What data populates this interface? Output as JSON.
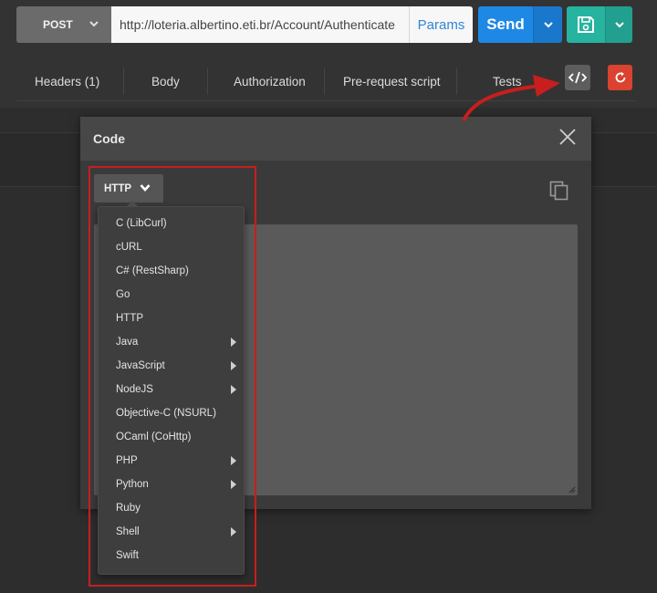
{
  "request": {
    "method": "POST",
    "url": "http://loteria.albertino.eti.br/Account/Authenticate",
    "params_label": "Params",
    "send_label": "Send"
  },
  "tabs": [
    {
      "label": "Headers (1)"
    },
    {
      "label": "Body"
    },
    {
      "label": "Authorization"
    },
    {
      "label": "Pre-request script"
    },
    {
      "label": "Tests"
    }
  ],
  "modal": {
    "title": "Code",
    "selected_language": "HTTP",
    "languages": [
      {
        "label": "C (LibCurl)",
        "submenu": false
      },
      {
        "label": "cURL",
        "submenu": false
      },
      {
        "label": "C# (RestSharp)",
        "submenu": false
      },
      {
        "label": "Go",
        "submenu": false
      },
      {
        "label": "HTTP",
        "submenu": false
      },
      {
        "label": "Java",
        "submenu": true
      },
      {
        "label": "JavaScript",
        "submenu": true
      },
      {
        "label": "NodeJS",
        "submenu": true
      },
      {
        "label": "Objective-C (NSURL)",
        "submenu": false
      },
      {
        "label": "OCaml (CoHttp)",
        "submenu": false
      },
      {
        "label": "PHP",
        "submenu": true
      },
      {
        "label": "Python",
        "submenu": true
      },
      {
        "label": "Ruby",
        "submenu": false
      },
      {
        "label": "Shell",
        "submenu": true
      },
      {
        "label": "Swift",
        "submenu": false
      }
    ]
  },
  "icons": {
    "method_chevron": "chevron-down-icon",
    "send_chevron": "chevron-down-icon",
    "save": "floppy-disk-icon",
    "save_chevron": "chevron-down-icon",
    "generate_code": "code-brackets-icon",
    "reset": "refresh-icon",
    "close": "close-icon",
    "copy": "copy-icon",
    "submenu": "caret-right-icon"
  },
  "colors": {
    "send": "#1e88e5",
    "save": "#26b3a0",
    "reset": "#d9432f",
    "annotation": "#c81e1e"
  }
}
